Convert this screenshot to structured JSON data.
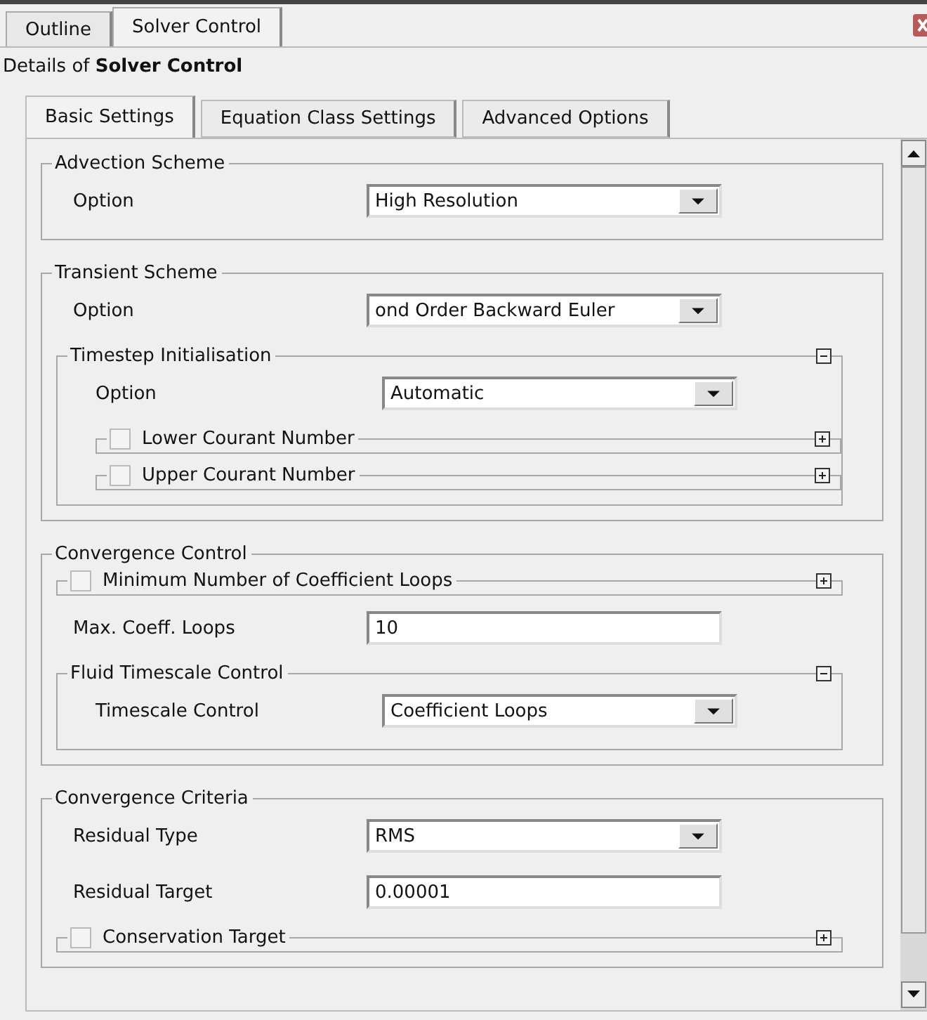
{
  "outer_tabs": [
    {
      "label": "Outline",
      "selected": false
    },
    {
      "label": "Solver Control",
      "selected": true
    }
  ],
  "details": "Details of **Solver Control**",
  "inner_tabs": [
    {
      "label": "Basic Settings",
      "selected": true
    },
    {
      "label": "Equation Class Settings",
      "selected": false
    },
    {
      "label": "Advanced Options",
      "selected": false
    }
  ],
  "sections": [
    {
      "title": "Advection Scheme",
      "items": [
        {
          "kind": "dropdown",
          "label": "Option",
          "value": "High Resolution"
        }
      ]
    },
    {
      "title": "Transient Scheme",
      "items": [
        {
          "kind": "dropdown",
          "label": "Option",
          "value": "ond Order Backward Euler"
        },
        {
          "kind": "group",
          "title": "Timestep Initialisation",
          "expanded": true,
          "items": [
            {
              "kind": "dropdown",
              "label": "Option",
              "value": "Automatic"
            },
            {
              "kind": "optional",
              "label": "Lower Courant Number",
              "checked": false,
              "expanded": false
            },
            {
              "kind": "optional",
              "label": "Upper Courant Number",
              "checked": false,
              "expanded": false
            }
          ]
        }
      ]
    },
    {
      "title": "Convergence Control",
      "items": [
        {
          "kind": "optional",
          "label": "Minimum Number of Coefficient Loops",
          "checked": false,
          "expanded": false
        },
        {
          "kind": "text",
          "label": "Max. Coeff. Loops",
          "value": "10"
        },
        {
          "kind": "group",
          "title": "Fluid Timescale Control",
          "expanded": true,
          "items": [
            {
              "kind": "dropdown",
              "label": "Timescale Control",
              "value": "Coefficient Loops"
            }
          ]
        }
      ]
    },
    {
      "title": "Convergence Criteria",
      "items": [
        {
          "kind": "dropdown",
          "label": "Residual Type",
          "value": "RMS"
        },
        {
          "kind": "text",
          "label": "Residual Target",
          "value": "0.00001"
        },
        {
          "kind": "optional",
          "label": "Conservation Target",
          "checked": false,
          "expanded": false
        }
      ]
    }
  ]
}
